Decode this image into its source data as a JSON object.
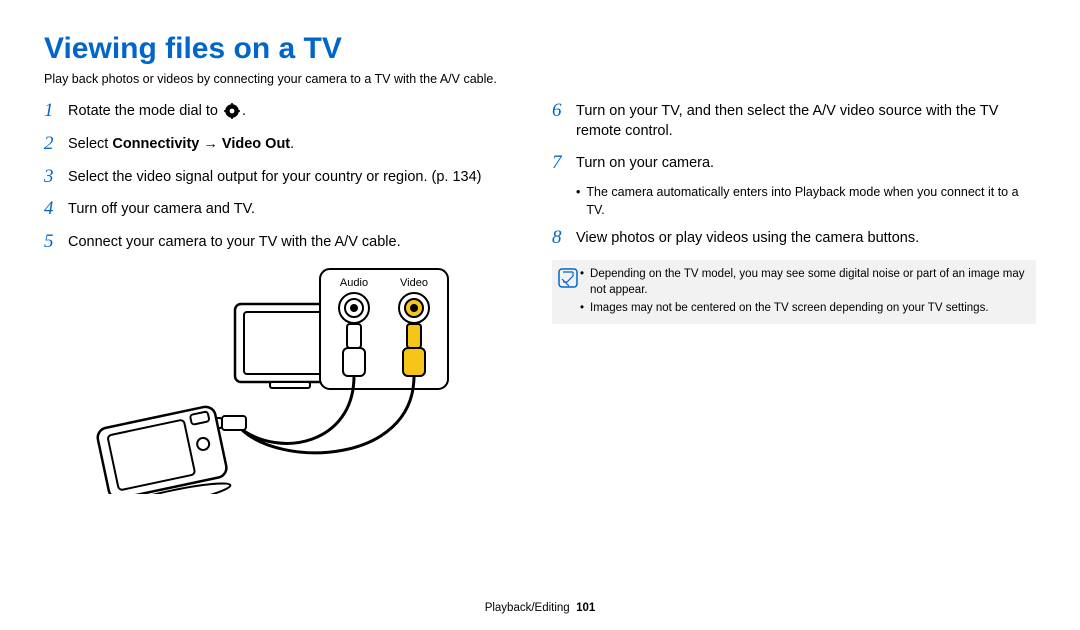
{
  "title": "Viewing files on a TV",
  "subtitle": "Play back photos or videos by connecting your camera to a TV with the A/V cable.",
  "left_steps": [
    {
      "num": "1",
      "pre": "Rotate the mode dial to ",
      "icon": true,
      "post": "."
    },
    {
      "num": "2",
      "pre": "Select ",
      "bold": "Connectivity → Video Out",
      "post": "."
    },
    {
      "num": "3",
      "pre": "Select the video signal output for your country or region. (p. 134)"
    },
    {
      "num": "4",
      "pre": "Turn off your camera and TV."
    },
    {
      "num": "5",
      "pre": "Connect your camera to your TV with the A/V cable."
    }
  ],
  "right_steps": [
    {
      "num": "6",
      "pre": "Turn on your TV, and then select the A/V video source with the TV remote control."
    },
    {
      "num": "7",
      "pre": "Turn on your camera.",
      "subs": [
        "The camera automatically enters into Playback mode when you connect it to a TV."
      ]
    },
    {
      "num": "8",
      "pre": "View photos or play videos using the camera buttons."
    }
  ],
  "diagram_labels": {
    "audio": "Audio",
    "video": "Video"
  },
  "notes": [
    "Depending on the TV model, you may see some digital noise or part of an image may not appear.",
    "Images may not be centered on the TV screen depending on your TV settings."
  ],
  "footer_section": "Playback/Editing",
  "footer_page": "101"
}
